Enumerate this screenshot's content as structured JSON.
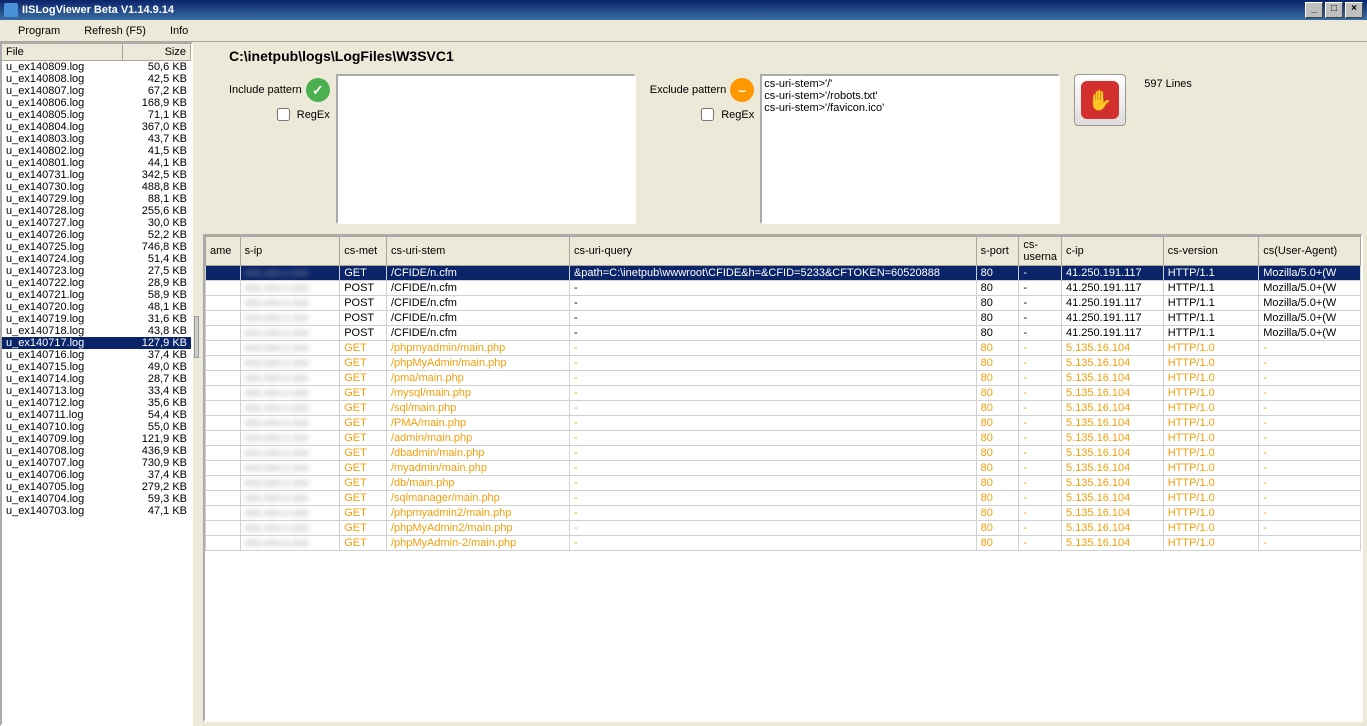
{
  "window": {
    "title": "IISLogViewer Beta V1.14.9.14"
  },
  "menu": {
    "program": "Program",
    "refresh": "Refresh (F5)",
    "info": "Info"
  },
  "sidebar": {
    "col_file": "File",
    "col_size": "Size",
    "files": [
      {
        "n": "u_ex140809.log",
        "s": "50,6 KB"
      },
      {
        "n": "u_ex140808.log",
        "s": "42,5 KB"
      },
      {
        "n": "u_ex140807.log",
        "s": "67,2 KB"
      },
      {
        "n": "u_ex140806.log",
        "s": "168,9 KB"
      },
      {
        "n": "u_ex140805.log",
        "s": "71,1 KB"
      },
      {
        "n": "u_ex140804.log",
        "s": "367,0 KB"
      },
      {
        "n": "u_ex140803.log",
        "s": "43,7 KB"
      },
      {
        "n": "u_ex140802.log",
        "s": "41,5 KB"
      },
      {
        "n": "u_ex140801.log",
        "s": "44,1 KB"
      },
      {
        "n": "u_ex140731.log",
        "s": "342,5 KB"
      },
      {
        "n": "u_ex140730.log",
        "s": "488,8 KB"
      },
      {
        "n": "u_ex140729.log",
        "s": "88,1 KB"
      },
      {
        "n": "u_ex140728.log",
        "s": "255,6 KB"
      },
      {
        "n": "u_ex140727.log",
        "s": "30,0 KB"
      },
      {
        "n": "u_ex140726.log",
        "s": "52,2 KB"
      },
      {
        "n": "u_ex140725.log",
        "s": "746,8 KB"
      },
      {
        "n": "u_ex140724.log",
        "s": "51,4 KB"
      },
      {
        "n": "u_ex140723.log",
        "s": "27,5 KB"
      },
      {
        "n": "u_ex140722.log",
        "s": "28,9 KB"
      },
      {
        "n": "u_ex140721.log",
        "s": "58,9 KB"
      },
      {
        "n": "u_ex140720.log",
        "s": "48,1 KB"
      },
      {
        "n": "u_ex140719.log",
        "s": "31,6 KB"
      },
      {
        "n": "u_ex140718.log",
        "s": "43,8 KB"
      },
      {
        "n": "u_ex140717.log",
        "s": "127,9 KB",
        "sel": true
      },
      {
        "n": "u_ex140716.log",
        "s": "37,4 KB"
      },
      {
        "n": "u_ex140715.log",
        "s": "49,0 KB"
      },
      {
        "n": "u_ex140714.log",
        "s": "28,7 KB"
      },
      {
        "n": "u_ex140713.log",
        "s": "33,4 KB"
      },
      {
        "n": "u_ex140712.log",
        "s": "35,6 KB"
      },
      {
        "n": "u_ex140711.log",
        "s": "54,4 KB"
      },
      {
        "n": "u_ex140710.log",
        "s": "55,0 KB"
      },
      {
        "n": "u_ex140709.log",
        "s": "121,9 KB"
      },
      {
        "n": "u_ex140708.log",
        "s": "436,9 KB"
      },
      {
        "n": "u_ex140707.log",
        "s": "730,9 KB"
      },
      {
        "n": "u_ex140706.log",
        "s": "37,4 KB"
      },
      {
        "n": "u_ex140705.log",
        "s": "279,2 KB"
      },
      {
        "n": "u_ex140704.log",
        "s": "59,3 KB"
      },
      {
        "n": "u_ex140703.log",
        "s": "47,1 KB"
      }
    ]
  },
  "path": "C:\\inetpub\\logs\\LogFiles\\W3SVC1",
  "filters": {
    "include_label": "Include pattern",
    "exclude_label": "Exclude pattern",
    "regex_label": "RegEx",
    "include_text": "",
    "exclude_text": "cs-uri-stem>'/'\ncs-uri-stem>'/robots.txt'\ncs-uri-stem>'/favicon.ico'"
  },
  "lines": "597 Lines",
  "grid": {
    "cols": [
      "ame",
      "s-ip",
      "cs-met",
      "cs-uri-stem",
      "cs-uri-query",
      "s-port",
      "cs-userna",
      "c-ip",
      "cs-version",
      "cs(User-Agent)"
    ],
    "rows": [
      {
        "m": "GET",
        "stem": "/CFIDE/n.cfm",
        "q": "&path=C:\\inetpub\\wwwroot\\CFIDE&h=&CFID=5233&CFTOKEN=60520888",
        "p": "80",
        "u": "-",
        "ip": "41.250.191.117",
        "v": "HTTP/1.1",
        "ua": "Mozilla/5.0+(W",
        "sel": true
      },
      {
        "m": "POST",
        "stem": "/CFIDE/n.cfm",
        "q": "-",
        "p": "80",
        "u": "-",
        "ip": "41.250.191.117",
        "v": "HTTP/1.1",
        "ua": "Mozilla/5.0+(W"
      },
      {
        "m": "POST",
        "stem": "/CFIDE/n.cfm",
        "q": "-",
        "p": "80",
        "u": "-",
        "ip": "41.250.191.117",
        "v": "HTTP/1.1",
        "ua": "Mozilla/5.0+(W"
      },
      {
        "m": "POST",
        "stem": "/CFIDE/n.cfm",
        "q": "-",
        "p": "80",
        "u": "-",
        "ip": "41.250.191.117",
        "v": "HTTP/1.1",
        "ua": "Mozilla/5.0+(W"
      },
      {
        "m": "POST",
        "stem": "/CFIDE/n.cfm",
        "q": "-",
        "p": "80",
        "u": "-",
        "ip": "41.250.191.117",
        "v": "HTTP/1.1",
        "ua": "Mozilla/5.0+(W"
      },
      {
        "m": "GET",
        "stem": "/phpmyadmin/main.php",
        "q": "-",
        "p": "80",
        "u": "-",
        "ip": "5.135.16.104",
        "v": "HTTP/1.0",
        "ua": "-",
        "warn": true
      },
      {
        "m": "GET",
        "stem": "/phpMyAdmin/main.php",
        "q": "-",
        "p": "80",
        "u": "-",
        "ip": "5.135.16.104",
        "v": "HTTP/1.0",
        "ua": "-",
        "warn": true
      },
      {
        "m": "GET",
        "stem": "/pma/main.php",
        "q": "-",
        "p": "80",
        "u": "-",
        "ip": "5.135.16.104",
        "v": "HTTP/1.0",
        "ua": "-",
        "warn": true
      },
      {
        "m": "GET",
        "stem": "/mysql/main.php",
        "q": "-",
        "p": "80",
        "u": "-",
        "ip": "5.135.16.104",
        "v": "HTTP/1.0",
        "ua": "-",
        "warn": true
      },
      {
        "m": "GET",
        "stem": "/sql/main.php",
        "q": "-",
        "p": "80",
        "u": "-",
        "ip": "5.135.16.104",
        "v": "HTTP/1.0",
        "ua": "-",
        "warn": true
      },
      {
        "m": "GET",
        "stem": "/PMA/main.php",
        "q": "-",
        "p": "80",
        "u": "-",
        "ip": "5.135.16.104",
        "v": "HTTP/1.0",
        "ua": "-",
        "warn": true
      },
      {
        "m": "GET",
        "stem": "/admin/main.php",
        "q": "-",
        "p": "80",
        "u": "-",
        "ip": "5.135.16.104",
        "v": "HTTP/1.0",
        "ua": "-",
        "warn": true
      },
      {
        "m": "GET",
        "stem": "/dbadmin/main.php",
        "q": "-",
        "p": "80",
        "u": "-",
        "ip": "5.135.16.104",
        "v": "HTTP/1.0",
        "ua": "-",
        "warn": true
      },
      {
        "m": "GET",
        "stem": "/myadmin/main.php",
        "q": "-",
        "p": "80",
        "u": "-",
        "ip": "5.135.16.104",
        "v": "HTTP/1.0",
        "ua": "-",
        "warn": true
      },
      {
        "m": "GET",
        "stem": "/db/main.php",
        "q": "-",
        "p": "80",
        "u": "-",
        "ip": "5.135.16.104",
        "v": "HTTP/1.0",
        "ua": "-",
        "warn": true
      },
      {
        "m": "GET",
        "stem": "/sqlmanager/main.php",
        "q": "-",
        "p": "80",
        "u": "-",
        "ip": "5.135.16.104",
        "v": "HTTP/1.0",
        "ua": "-",
        "warn": true
      },
      {
        "m": "GET",
        "stem": "/phpmyadmin2/main.php",
        "q": "-",
        "p": "80",
        "u": "-",
        "ip": "5.135.16.104",
        "v": "HTTP/1.0",
        "ua": "-",
        "warn": true
      },
      {
        "m": "GET",
        "stem": "/phpMyAdmin2/main.php",
        "q": "-",
        "p": "80",
        "u": "-",
        "ip": "5.135.16.104",
        "v": "HTTP/1.0",
        "ua": "-",
        "warn": true
      },
      {
        "m": "GET",
        "stem": "/phpMyAdmin-2/main.php",
        "q": "-",
        "p": "80",
        "u": "-",
        "ip": "5.135.16.104",
        "v": "HTTP/1.0",
        "ua": "-",
        "warn": true
      }
    ]
  }
}
